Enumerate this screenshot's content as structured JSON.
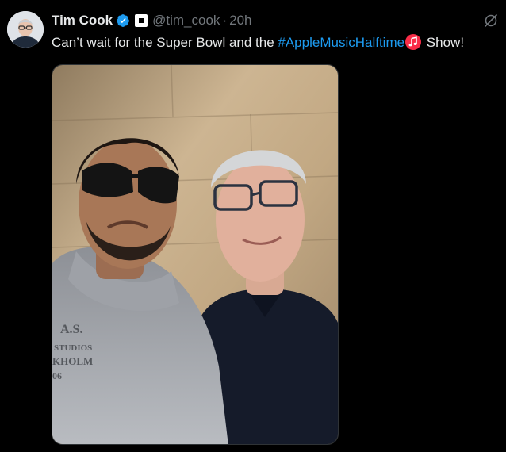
{
  "tweet": {
    "author_name": "Tim Cook",
    "handle": "@tim_cook",
    "separator": "·",
    "timestamp": "20h",
    "text_prefix": "Can’t wait for the Super Bowl and the ",
    "hashtag": "#AppleMusicHalftime",
    "text_suffix": " Show!",
    "emoji": "music-note-emoji",
    "photo_alt": "Selfie of two men in front of a stone wall"
  },
  "icons": {
    "verified": "verified-badge-icon",
    "affiliate": "affiliate-badge-icon",
    "grok": "grok-icon"
  },
  "colors": {
    "background": "#000000",
    "text": "#e7e9ea",
    "muted": "#71767b",
    "link": "#1d9bf0",
    "verified": "#1d9bf0",
    "emoji_red": "#fa2d48"
  }
}
